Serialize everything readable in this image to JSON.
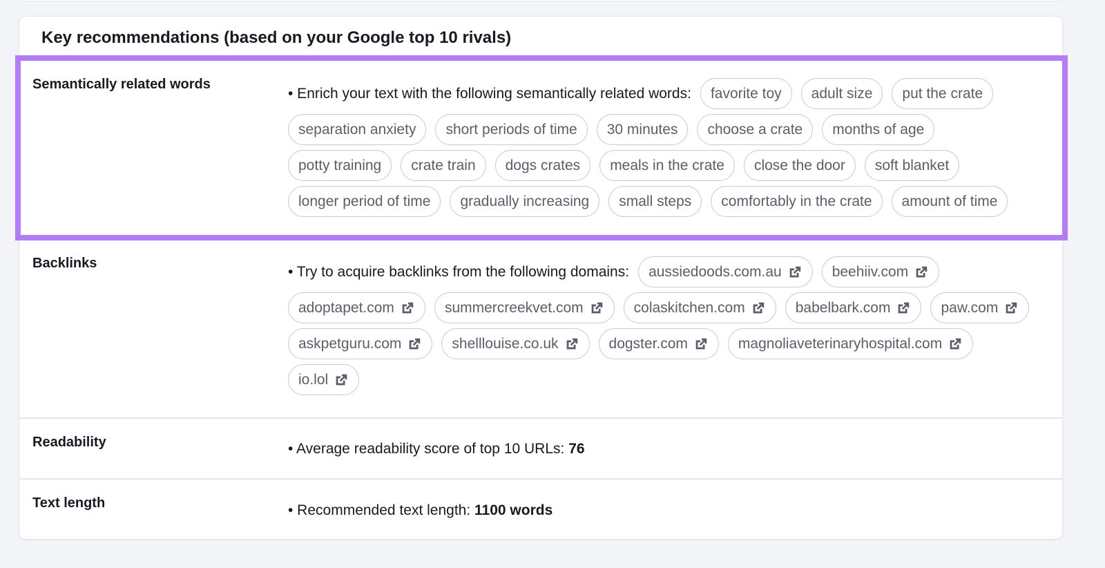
{
  "card": {
    "title": "Key recommendations (based on your Google top 10 rivals)"
  },
  "highlight_color": "#b57cf7",
  "semantic": {
    "label": "Semantically related words",
    "intro": "• Enrich your text with the following semantically related words:",
    "words": [
      "favorite toy",
      "adult size",
      "put the crate",
      "separation anxiety",
      "short periods of time",
      "30 minutes",
      "choose a crate",
      "months of age",
      "potty training",
      "crate train",
      "dogs crates",
      "meals in the crate",
      "close the door",
      "soft blanket",
      "longer period of time",
      "gradually increasing",
      "small steps",
      "comfortably in the crate",
      "amount of time"
    ]
  },
  "backlinks": {
    "label": "Backlinks",
    "intro": "• Try to acquire backlinks from the following domains:",
    "domains": [
      "aussiedoods.com.au",
      "beehiiv.com",
      "adoptapet.com",
      "summercreekvet.com",
      "colaskitchen.com",
      "babelbark.com",
      "paw.com",
      "askpetguru.com",
      "shelllouise.co.uk",
      "dogster.com",
      "magnoliaveterinaryhospital.com",
      "io.lol"
    ],
    "icon": "external-link-icon"
  },
  "readability": {
    "label": "Readability",
    "text": "• Average readability score of top 10 URLs:",
    "value": "76"
  },
  "text_length": {
    "label": "Text length",
    "text": "• Recommended text length:",
    "value": "1100 words"
  }
}
